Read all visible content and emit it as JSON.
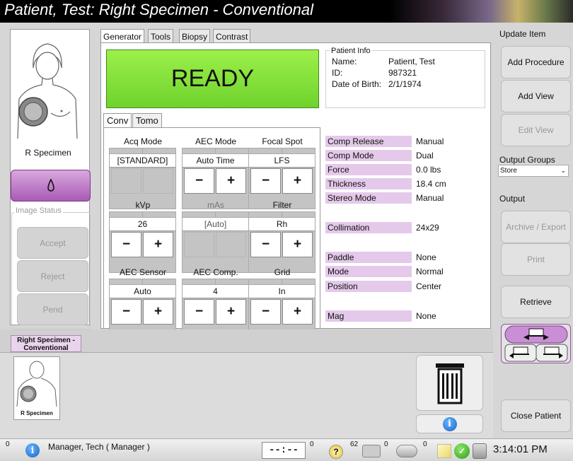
{
  "title": "Patient, Test:  Right Specimen - Conventional",
  "tabs": [
    "Generator",
    "Tools",
    "Biopsy",
    "Contrast"
  ],
  "left": {
    "specimen_label": "R Specimen",
    "image_status_title": "Image Status",
    "status_buttons": [
      "Accept",
      "Reject",
      "Pend"
    ]
  },
  "ready_text": "READY",
  "patient_info": {
    "title": "Patient Info",
    "name_label": "Name:",
    "name": "Patient, Test",
    "id_label": "ID:",
    "id": "987321",
    "dob_label": "Date of Birth:",
    "dob": "2/1/1974"
  },
  "subtabs": [
    "Conv",
    "Tomo"
  ],
  "controls": [
    {
      "label": "Acq Mode",
      "value": "[STANDARD]",
      "buttons": false,
      "enabled": true
    },
    {
      "label": "AEC Mode",
      "value": "Auto Time",
      "buttons": true,
      "enabled": true
    },
    {
      "label": "Focal Spot",
      "value": "LFS",
      "buttons": true,
      "enabled": true
    },
    {
      "label": "kVp",
      "value": "26",
      "buttons": true,
      "enabled": true
    },
    {
      "label": "mAs",
      "value": "[Auto]",
      "buttons": false,
      "enabled": false
    },
    {
      "label": "Filter",
      "value": "Rh",
      "buttons": true,
      "enabled": true
    },
    {
      "label": "AEC Sensor",
      "value": "Auto",
      "buttons": true,
      "enabled": true
    },
    {
      "label": "AEC Comp.",
      "value": "4",
      "buttons": true,
      "enabled": true
    },
    {
      "label": "Grid",
      "value": "In",
      "buttons": true,
      "enabled": true
    }
  ],
  "minus": "−",
  "plus": "+",
  "properties": [
    {
      "label": "Comp Release",
      "value": "Manual"
    },
    {
      "label": "Comp Mode",
      "value": "Dual"
    },
    {
      "label": "Force",
      "value": "0.0 lbs"
    },
    {
      "label": "Thickness",
      "value": "18.4 cm"
    },
    {
      "label": "Stereo Mode",
      "value": "Manual"
    },
    {
      "label": "Collimation",
      "value": "24x29"
    },
    {
      "label": "Paddle",
      "value": "None"
    },
    {
      "label": "Mode",
      "value": "Normal"
    },
    {
      "label": "Position",
      "value": "Center"
    },
    {
      "label": "Mag",
      "value": "None"
    }
  ],
  "right": {
    "update_item": "Update Item",
    "add_procedure": "Add Procedure",
    "add_view": "Add View",
    "edit_view": "Edit View",
    "output_groups": "Output Groups",
    "store": "Store",
    "output": "Output",
    "archive_export": "Archive / Export",
    "print": "Print",
    "retrieve": "Retrieve",
    "close_patient": "Close Patient"
  },
  "thumb": {
    "tab_label": "Right Specimen - Conventional",
    "caption": "R Specimen"
  },
  "taskbar": {
    "alarm_count": "0",
    "user": "Manager, Tech ( Manager )",
    "timer": "--:--",
    "timer_count": "0",
    "help_count": "62",
    "detector_count": "0",
    "tube_count": "0",
    "time": "3:14:01 PM"
  }
}
